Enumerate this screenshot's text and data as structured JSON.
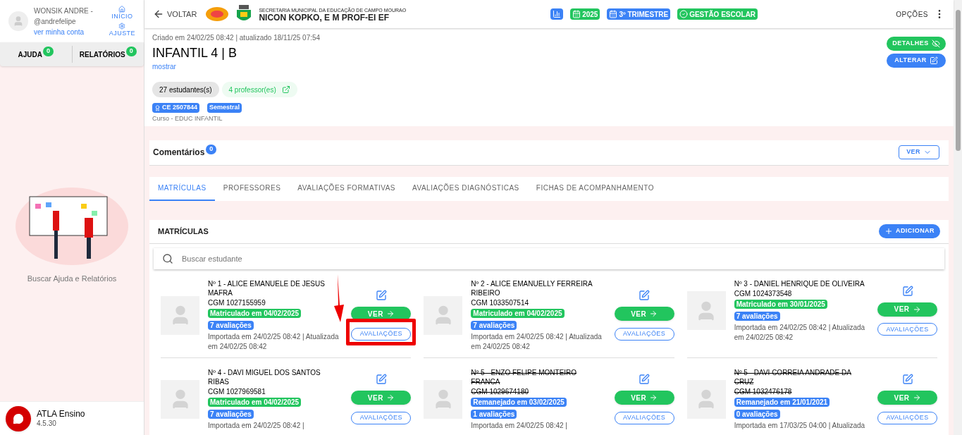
{
  "user": {
    "name": "WONSIK ANDRE -",
    "handle": "@andrefelipe",
    "account_link": "ver minha conta"
  },
  "quick_links": [
    {
      "label": "INÍCIO"
    },
    {
      "label": "AJUSTE"
    }
  ],
  "sidebar_tabs": [
    {
      "label": "AJUDA",
      "count": "0"
    },
    {
      "label": "RELATÓRIOS",
      "count": "0"
    }
  ],
  "help_caption": "Buscar Ajuda e Relatórios",
  "app_info": {
    "name": "ATLA Ensino",
    "version": "4.5.30"
  },
  "topbar": {
    "back": "VOLTAR",
    "org": "SECRETARIA MUNICIPAL DA EDUCAÇÃO DE CAMPO MOURAO",
    "school": "NICON KOPKO, E M PROF-EI EF",
    "options": "OPÇÕES",
    "tags": [
      {
        "kind": "chart",
        "color": "#3b82f6"
      },
      {
        "kind": "calendar",
        "label": "2025",
        "color": "#22c55e"
      },
      {
        "kind": "calendar",
        "label": "3º TRIMESTRE",
        "color": "#3b82f6"
      },
      {
        "kind": "check",
        "label": "GESTÃO ESCOLAR",
        "color": "#22c55e"
      }
    ]
  },
  "class_info": {
    "meta": "Criado em 24/02/25 08:42 | atualizado 18/11/25 07:54",
    "title": "INFANTIL 4 | B",
    "show_link": "mostrar",
    "actions": [
      {
        "kind": "details",
        "label": "DETALHES"
      },
      {
        "kind": "edit",
        "label": "ALTERAR"
      }
    ],
    "students_pill": "27 estudantes(s)",
    "teachers_pill": "4 professor(es)",
    "badges": [
      {
        "kind": "code",
        "label": "CE 2507844"
      },
      {
        "kind": "plain",
        "label": "Semestral"
      }
    ],
    "course": "Curso - EDUC INFANTIL"
  },
  "comments": {
    "title": "Comentários",
    "count": "0",
    "button": "VER"
  },
  "tabs": [
    {
      "label": "MATRÍCULAS",
      "selected": true
    },
    {
      "label": "PROFESSORES",
      "selected": false
    },
    {
      "label": "AVALIAÇÕES FORMATIVAS",
      "selected": false
    },
    {
      "label": "AVALIAÇÕES DIAGNÓSTICAS",
      "selected": false
    },
    {
      "label": "FICHAS DE ACOMPANHAMENTO",
      "selected": false
    }
  ],
  "enrollments": {
    "title": "MATRÍCULAS",
    "add_button": "ADICIONAR",
    "search_placeholder": "Buscar estudante",
    "students": [
      {
        "kind": "enrolled",
        "name": "Nº 1 - ALICE EMANUELE DE JESUS MAFRA",
        "cgm": "CGM 1027155959",
        "status": "Matriculado em 04/02/2025",
        "evaluations": "7 avaliações",
        "note": "Importada em 24/02/25 08:42 | Atualizada em 24/02/25 08:42",
        "view": "VER",
        "evals_button": "AVALIAÇÕES",
        "highlighted": true
      },
      {
        "kind": "enrolled",
        "name": "Nº 2 - ALICE EMANUELLY FERREIRA RIBEIRO",
        "cgm": "CGM 1033507514",
        "status": "Matriculado em 04/02/2025",
        "evaluations": "7 avaliações",
        "note": "Importada em 24/02/25 08:42 | Atualizada em 24/02/25 08:42",
        "view": "VER",
        "evals_button": "AVALIAÇÕES",
        "highlighted": false
      },
      {
        "kind": "enrolled",
        "name": "Nº 3 - DANIEL HENRIQUE DE OLIVEIRA",
        "cgm": "CGM 1024373548",
        "status": "Matriculado em 30/01/2025",
        "evaluations": "7 avaliações",
        "note": "Importada em 24/02/25 08:42 | Atualizada em 24/02/25 08:42",
        "view": "VER",
        "evals_button": "AVALIAÇÕES",
        "highlighted": false
      },
      {
        "kind": "enrolled",
        "name": "Nº 4 - DAVI MIGUEL DOS SANTOS RIBAS",
        "cgm": "CGM 1027969581",
        "status": "Matriculado em 04/02/2025",
        "evaluations": "7 avaliações",
        "note": "Importada em 24/02/25 08:42 |",
        "view": "VER",
        "evals_button": "AVALIAÇÕES",
        "highlighted": false
      },
      {
        "kind": "transferred",
        "name": "Nº 5 - ENZO FELIPE MONTEIRO FRANCA",
        "cgm": "CGM 1029674180",
        "status": "Remanejado em 03/02/2025",
        "evaluations": "1 avaliações",
        "note": "Importada em 24/02/25 08:42 |",
        "view": "VER",
        "evals_button": "AVALIAÇÕES",
        "highlighted": false
      },
      {
        "kind": "transferred",
        "name": "Nº 5 - DAVI CORREIA ANDRADE DA CRUZ",
        "cgm": "CGM 1032476178",
        "status": "Remanejado em 21/01/2021",
        "evaluations": "0 avaliações",
        "note": "Importada em 17/03/25 04:00 | Atualizada",
        "view": "VER",
        "evals_button": "AVALIAÇÕES",
        "highlighted": false
      }
    ]
  }
}
